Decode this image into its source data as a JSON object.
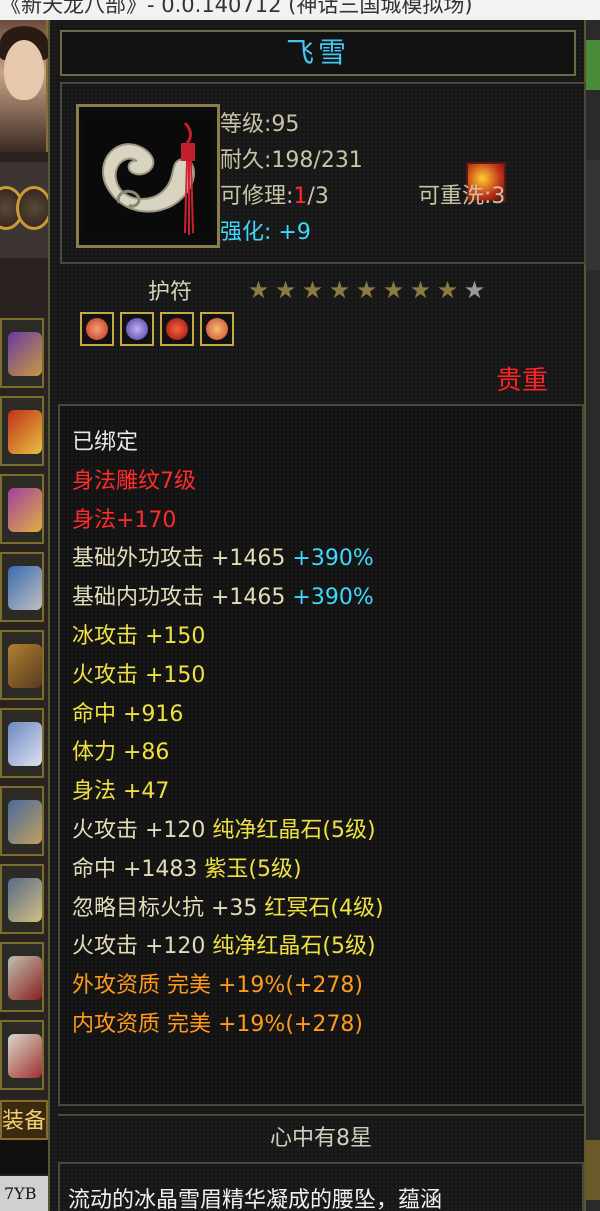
{
  "window": {
    "title": "《新天龙八部》- 0.0.140712 (神话三国城模拟场)"
  },
  "item": {
    "name": "飞雪",
    "level_label": "等级:95",
    "durability_label": "耐久:198/231",
    "repair_label": "可修理:",
    "repair_used": "1",
    "repair_max": "/3",
    "rewash_label": "可重洗:3",
    "enhance_label": "强化:",
    "enhance_value": "+9",
    "type": "护符",
    "stars_filled": 8,
    "stars_total": 9,
    "gems": [
      "red-orange gem",
      "purple gem",
      "red gem",
      "orange gem"
    ],
    "grade": "贵重"
  },
  "attributes": [
    {
      "text": "已绑定",
      "value": "",
      "cls": "c-white"
    },
    {
      "text": "身法雕纹7级",
      "value": "",
      "cls": "c-red"
    },
    {
      "text": "身法+170",
      "value": "",
      "cls": "c-red"
    },
    {
      "text": "基础外功攻击 +1465 ",
      "value": "+390%",
      "cls": "c-light",
      "vcls": "v-cyan"
    },
    {
      "text": "基础内功攻击 +1465 ",
      "value": "+390%",
      "cls": "c-light",
      "vcls": "v-cyan"
    },
    {
      "text": "冰攻击 +150",
      "value": "",
      "cls": "c-yellow"
    },
    {
      "text": "火攻击 +150",
      "value": "",
      "cls": "c-yellow"
    },
    {
      "text": "命中 +916",
      "value": "",
      "cls": "c-yellow"
    },
    {
      "text": "体力 +86",
      "value": "",
      "cls": "c-yellow"
    },
    {
      "text": "身法 +47",
      "value": "",
      "cls": "c-yellow"
    },
    {
      "text": "火攻击 +120 ",
      "value": "纯净红晶石(5级)",
      "cls": "c-light",
      "vcls": "v-yellow"
    },
    {
      "text": "命中 +1483 ",
      "value": "紫玉(5级)",
      "cls": "c-light",
      "vcls": "v-yellow"
    },
    {
      "text": "忽略目标火抗 +35 ",
      "value": "红冥石(4级)",
      "cls": "c-light",
      "vcls": "v-yellow"
    },
    {
      "text": "火攻击 +120 ",
      "value": "纯净红晶石(5级)",
      "cls": "c-light",
      "vcls": "v-yellow"
    },
    {
      "text": "外攻资质  完美 +19%(+278)",
      "value": "",
      "cls": "c-orange"
    },
    {
      "text": "内攻资质  完美 +19%(+278)",
      "value": "",
      "cls": "c-orange"
    }
  ],
  "set_title": "心中有8星",
  "description": "流动的冰晶雪眉精华凝成的腰坠，蕴涵",
  "sidebar": {
    "equip_label": "装备",
    "code": "7YB"
  },
  "colors": {
    "title": "#40c8f0",
    "grade": "#ff2222",
    "border": "#4a4838"
  }
}
